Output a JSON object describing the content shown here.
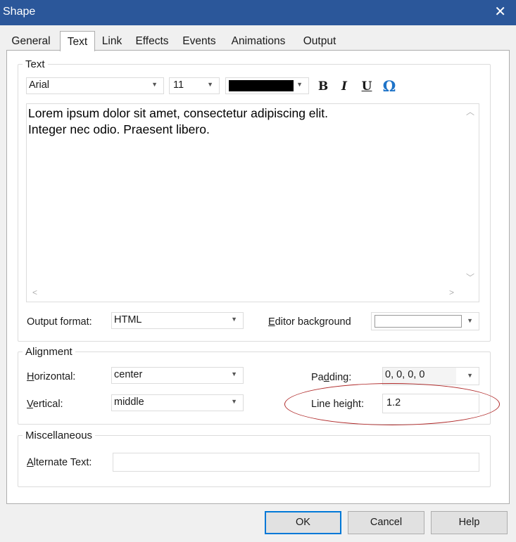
{
  "window": {
    "title": "Shape"
  },
  "tabs": [
    {
      "label": "General"
    },
    {
      "label": "Text"
    },
    {
      "label": "Link"
    },
    {
      "label": "Effects"
    },
    {
      "label": "Events"
    },
    {
      "label": "Animations"
    },
    {
      "label": "Output"
    }
  ],
  "active_tab": "Text",
  "text_group": {
    "legend": "Text",
    "font_family": "Arial",
    "font_size": "11",
    "font_color": "#000000",
    "bold_label": "B",
    "italic_label": "I",
    "underline_label": "U",
    "symbol_label": "Ω",
    "symbol_color": "#1e73c8",
    "content_line1": "Lorem ipsum dolor sit amet, consectetur adipiscing elit.",
    "content_line2": "Integer nec odio. Praesent libero.",
    "output_format_label": "Output format:",
    "output_format_value": "HTML",
    "editor_background_label": "Editor background",
    "editor_background_value": ""
  },
  "alignment_group": {
    "legend": "Alignment",
    "horizontal_label": "Horizontal:",
    "horizontal_value": "center",
    "vertical_label": "Vertical:",
    "vertical_value": "middle",
    "padding_label": "Padding:",
    "padding_value": "0, 0, 0, 0",
    "line_height_label": "Line height:",
    "line_height_value": "1.2"
  },
  "misc_group": {
    "legend": "Miscellaneous",
    "alt_text_label": "Alternate Text:",
    "alt_text_value": ""
  },
  "buttons": {
    "ok": "OK",
    "cancel": "Cancel",
    "help": "Help"
  },
  "colors": {
    "titlebar": "#2b579a",
    "annotation": "#b02a2a",
    "default_button_border": "#0078d7"
  }
}
